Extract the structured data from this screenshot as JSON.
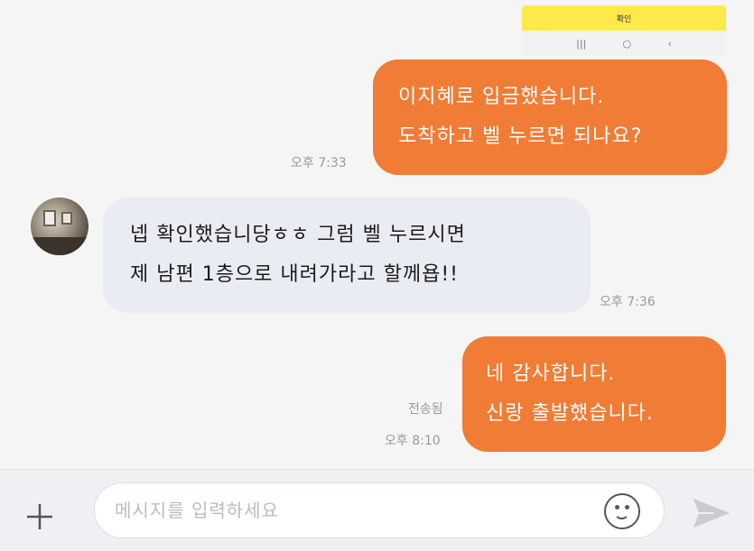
{
  "thumbnail": {
    "button_label": "확인",
    "nav_icons": [
      "recent-apps-icon",
      "home-icon",
      "back-icon"
    ]
  },
  "messages": [
    {
      "sender": "me",
      "lines": [
        "이지혜로 입금했습니다.",
        "도착하고 벨 누르면 되나요?"
      ],
      "time": "오후 7:33",
      "status": ""
    },
    {
      "sender": "other",
      "lines": [
        "넵 확인했습니당ㅎㅎ 그럼 벨 누르시면",
        "제 남편 1층으로 내려가라고 할께욥!!"
      ],
      "time": "오후 7:36",
      "status": ""
    },
    {
      "sender": "me",
      "lines": [
        "네 감사합니다.",
        "신랑 출발했습니다."
      ],
      "time": "오후 8:10",
      "status": "전송됨"
    }
  ],
  "input": {
    "placeholder": "메시지를 입력하세요",
    "value": ""
  },
  "colors": {
    "my_bubble": "#f07c35",
    "other_bubble": "#e9ecf2",
    "background": "#f5f5f5",
    "thumbnail_bar": "#fde94a"
  }
}
